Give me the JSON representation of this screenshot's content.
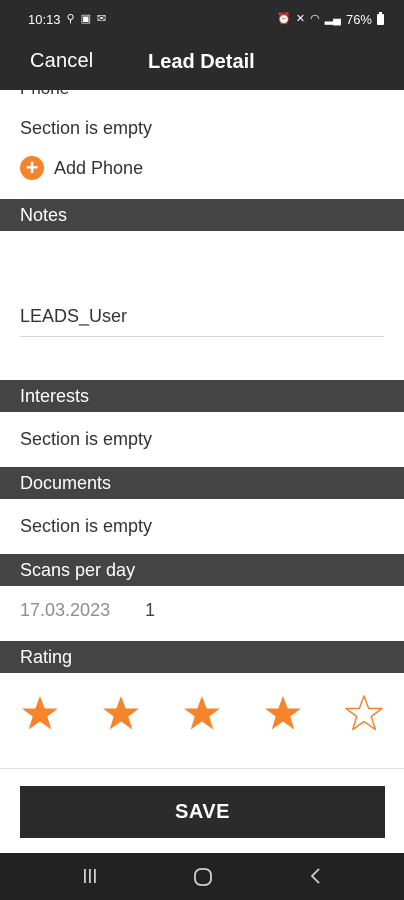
{
  "status_bar": {
    "time": "10:13",
    "battery": "76%"
  },
  "header": {
    "cancel_label": "Cancel",
    "title": "Lead Detail"
  },
  "phone": {
    "clipped_title": "Phone",
    "empty_text": "Section is empty",
    "add_label": "Add Phone"
  },
  "notes": {
    "title": "Notes",
    "value": "LEADS_User"
  },
  "interests": {
    "title": "Interests",
    "empty_text": "Section is empty"
  },
  "documents": {
    "title": "Documents",
    "empty_text": "Section is empty"
  },
  "scans": {
    "title": "Scans per day",
    "date": "17.03.2023",
    "count": "1"
  },
  "rating": {
    "title": "Rating",
    "value": 4,
    "max": 5,
    "accent_color": "#f5842a"
  },
  "save_label": "SAVE",
  "icons": [
    "plus-icon",
    "star-icon",
    "recents-icon",
    "home-icon",
    "back-icon"
  ]
}
